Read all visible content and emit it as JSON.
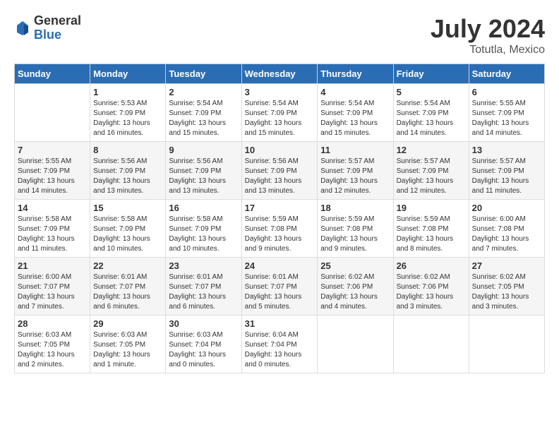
{
  "header": {
    "logo_general": "General",
    "logo_blue": "Blue",
    "month_year": "July 2024",
    "location": "Totutla, Mexico"
  },
  "days_of_week": [
    "Sunday",
    "Monday",
    "Tuesday",
    "Wednesday",
    "Thursday",
    "Friday",
    "Saturday"
  ],
  "weeks": [
    [
      {
        "num": "",
        "info": ""
      },
      {
        "num": "1",
        "info": "Sunrise: 5:53 AM\nSunset: 7:09 PM\nDaylight: 13 hours\nand 16 minutes."
      },
      {
        "num": "2",
        "info": "Sunrise: 5:54 AM\nSunset: 7:09 PM\nDaylight: 13 hours\nand 15 minutes."
      },
      {
        "num": "3",
        "info": "Sunrise: 5:54 AM\nSunset: 7:09 PM\nDaylight: 13 hours\nand 15 minutes."
      },
      {
        "num": "4",
        "info": "Sunrise: 5:54 AM\nSunset: 7:09 PM\nDaylight: 13 hours\nand 15 minutes."
      },
      {
        "num": "5",
        "info": "Sunrise: 5:54 AM\nSunset: 7:09 PM\nDaylight: 13 hours\nand 14 minutes."
      },
      {
        "num": "6",
        "info": "Sunrise: 5:55 AM\nSunset: 7:09 PM\nDaylight: 13 hours\nand 14 minutes."
      }
    ],
    [
      {
        "num": "7",
        "info": "Sunrise: 5:55 AM\nSunset: 7:09 PM\nDaylight: 13 hours\nand 14 minutes."
      },
      {
        "num": "8",
        "info": "Sunrise: 5:56 AM\nSunset: 7:09 PM\nDaylight: 13 hours\nand 13 minutes."
      },
      {
        "num": "9",
        "info": "Sunrise: 5:56 AM\nSunset: 7:09 PM\nDaylight: 13 hours\nand 13 minutes."
      },
      {
        "num": "10",
        "info": "Sunrise: 5:56 AM\nSunset: 7:09 PM\nDaylight: 13 hours\nand 13 minutes."
      },
      {
        "num": "11",
        "info": "Sunrise: 5:57 AM\nSunset: 7:09 PM\nDaylight: 13 hours\nand 12 minutes."
      },
      {
        "num": "12",
        "info": "Sunrise: 5:57 AM\nSunset: 7:09 PM\nDaylight: 13 hours\nand 12 minutes."
      },
      {
        "num": "13",
        "info": "Sunrise: 5:57 AM\nSunset: 7:09 PM\nDaylight: 13 hours\nand 11 minutes."
      }
    ],
    [
      {
        "num": "14",
        "info": "Sunrise: 5:58 AM\nSunset: 7:09 PM\nDaylight: 13 hours\nand 11 minutes."
      },
      {
        "num": "15",
        "info": "Sunrise: 5:58 AM\nSunset: 7:09 PM\nDaylight: 13 hours\nand 10 minutes."
      },
      {
        "num": "16",
        "info": "Sunrise: 5:58 AM\nSunset: 7:09 PM\nDaylight: 13 hours\nand 10 minutes."
      },
      {
        "num": "17",
        "info": "Sunrise: 5:59 AM\nSunset: 7:08 PM\nDaylight: 13 hours\nand 9 minutes."
      },
      {
        "num": "18",
        "info": "Sunrise: 5:59 AM\nSunset: 7:08 PM\nDaylight: 13 hours\nand 9 minutes."
      },
      {
        "num": "19",
        "info": "Sunrise: 5:59 AM\nSunset: 7:08 PM\nDaylight: 13 hours\nand 8 minutes."
      },
      {
        "num": "20",
        "info": "Sunrise: 6:00 AM\nSunset: 7:08 PM\nDaylight: 13 hours\nand 7 minutes."
      }
    ],
    [
      {
        "num": "21",
        "info": "Sunrise: 6:00 AM\nSunset: 7:07 PM\nDaylight: 13 hours\nand 7 minutes."
      },
      {
        "num": "22",
        "info": "Sunrise: 6:01 AM\nSunset: 7:07 PM\nDaylight: 13 hours\nand 6 minutes."
      },
      {
        "num": "23",
        "info": "Sunrise: 6:01 AM\nSunset: 7:07 PM\nDaylight: 13 hours\nand 6 minutes."
      },
      {
        "num": "24",
        "info": "Sunrise: 6:01 AM\nSunset: 7:07 PM\nDaylight: 13 hours\nand 5 minutes."
      },
      {
        "num": "25",
        "info": "Sunrise: 6:02 AM\nSunset: 7:06 PM\nDaylight: 13 hours\nand 4 minutes."
      },
      {
        "num": "26",
        "info": "Sunrise: 6:02 AM\nSunset: 7:06 PM\nDaylight: 13 hours\nand 3 minutes."
      },
      {
        "num": "27",
        "info": "Sunrise: 6:02 AM\nSunset: 7:05 PM\nDaylight: 13 hours\nand 3 minutes."
      }
    ],
    [
      {
        "num": "28",
        "info": "Sunrise: 6:03 AM\nSunset: 7:05 PM\nDaylight: 13 hours\nand 2 minutes."
      },
      {
        "num": "29",
        "info": "Sunrise: 6:03 AM\nSunset: 7:05 PM\nDaylight: 13 hours\nand 1 minute."
      },
      {
        "num": "30",
        "info": "Sunrise: 6:03 AM\nSunset: 7:04 PM\nDaylight: 13 hours\nand 0 minutes."
      },
      {
        "num": "31",
        "info": "Sunrise: 6:04 AM\nSunset: 7:04 PM\nDaylight: 13 hours\nand 0 minutes."
      },
      {
        "num": "",
        "info": ""
      },
      {
        "num": "",
        "info": ""
      },
      {
        "num": "",
        "info": ""
      }
    ]
  ]
}
